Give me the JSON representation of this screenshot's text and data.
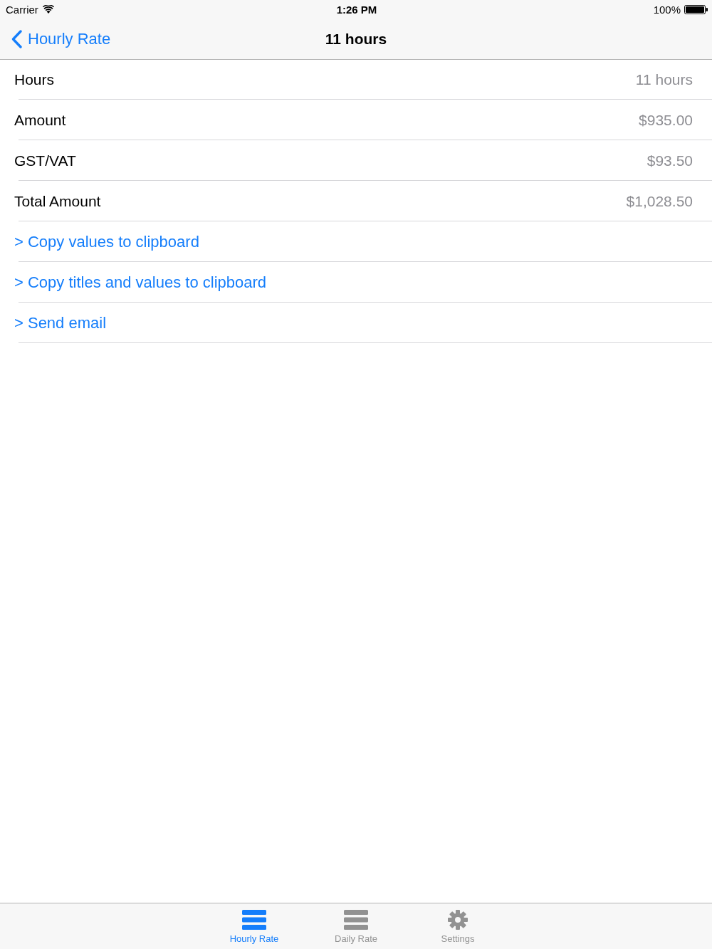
{
  "status_bar": {
    "carrier": "Carrier",
    "time": "1:26 PM",
    "battery": "100%"
  },
  "nav_bar": {
    "back_label": "Hourly Rate",
    "title": "11 hours"
  },
  "rows": [
    {
      "kind": "value",
      "label": "Hours",
      "value": "11 hours"
    },
    {
      "kind": "value",
      "label": "Amount",
      "value": "$935.00"
    },
    {
      "kind": "value",
      "label": "GST/VAT",
      "value": "$93.50"
    },
    {
      "kind": "value",
      "label": "Total Amount",
      "value": "$1,028.50"
    },
    {
      "kind": "action",
      "label": "> Copy values to clipboard"
    },
    {
      "kind": "action",
      "label": "> Copy titles and values to clipboard"
    },
    {
      "kind": "action",
      "label": "> Send email"
    }
  ],
  "tab_bar": {
    "tabs": [
      {
        "kind": "list",
        "label": "Hourly Rate",
        "selected": true
      },
      {
        "kind": "list",
        "label": "Daily Rate",
        "selected": false
      },
      {
        "kind": "gear",
        "label": "Settings",
        "selected": false
      }
    ]
  }
}
